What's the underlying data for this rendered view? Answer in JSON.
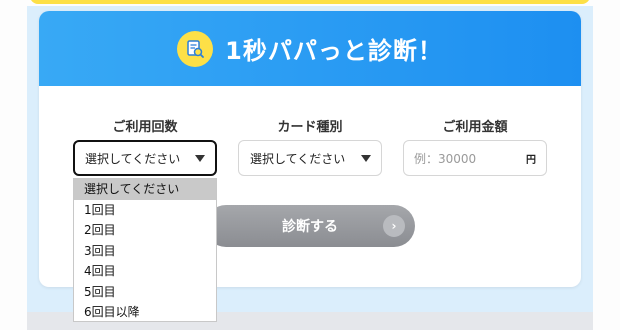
{
  "header": {
    "title": "1秒パパっと診断！",
    "icon": "document-search-icon"
  },
  "fields": {
    "usage_count": {
      "label": "ご利用回数",
      "value": "選択してください"
    },
    "card_type": {
      "label": "カード種別",
      "value": "選択してください"
    },
    "amount": {
      "label": "ご利用金額",
      "placeholder": "例：30000",
      "unit": "円"
    }
  },
  "dropdown": {
    "options": [
      "選択してください",
      "1回目",
      "2回目",
      "3回目",
      "4回目",
      "5回目",
      "6回目以降"
    ],
    "selected_index": 0
  },
  "submit": {
    "label": "診断する",
    "arrow": "›"
  },
  "colors": {
    "header": "#1d8ff1",
    "accent": "#fde047",
    "button": "#8b8d92"
  }
}
